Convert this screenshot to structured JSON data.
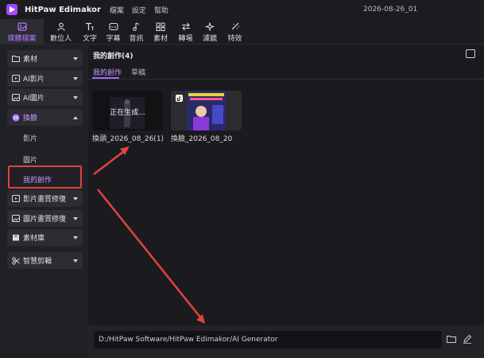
{
  "titlebar": {
    "app_name": "HitPaw Edimakor",
    "menu": [
      "檔案",
      "設定",
      "幫助"
    ],
    "project_name": "2026-08-26_01"
  },
  "toolbar": {
    "items": [
      {
        "label": "媒體檔案",
        "icon": "media-icon",
        "active": true
      },
      {
        "label": "數位人",
        "icon": "avatar-icon",
        "active": false
      },
      {
        "label": "文字",
        "icon": "text-icon",
        "active": false
      },
      {
        "label": "字幕",
        "icon": "subtitle-icon",
        "active": false
      },
      {
        "label": "音訊",
        "icon": "music-icon",
        "active": false
      },
      {
        "label": "素材",
        "icon": "sticker-icon",
        "active": false
      },
      {
        "label": "轉場",
        "icon": "transition-icon",
        "active": false
      },
      {
        "label": "濾鏡",
        "icon": "filter-icon",
        "active": false
      },
      {
        "label": "特效",
        "icon": "effects-icon",
        "active": false
      }
    ]
  },
  "sidebar": {
    "groups": [
      {
        "label": "素材",
        "icon": "folder-icon"
      },
      {
        "label": "AI影片",
        "icon": "ai-video-icon"
      },
      {
        "label": "AI圖片",
        "icon": "ai-image-icon"
      },
      {
        "label": "換臉",
        "icon": "face-swap-icon",
        "open": true
      },
      {
        "label": "影片畫質修復",
        "icon": "video-enhance-icon"
      },
      {
        "label": "圖片畫質修復",
        "icon": "image-enhance-icon"
      },
      {
        "label": "素材庫",
        "icon": "library-icon"
      },
      {
        "label": "智慧剪輯",
        "icon": "smart-cut-icon"
      }
    ],
    "subitems": [
      "影片",
      "圖片",
      "我的創作"
    ]
  },
  "main": {
    "title": "我的創作(4)",
    "tabs": [
      "我的創作",
      "草稿"
    ],
    "cards": [
      {
        "label": "換頭_2026_08_26(1)",
        "status": "正在生成..."
      },
      {
        "label": "換臉_2026_08_20",
        "status": ""
      }
    ]
  },
  "pathbar": {
    "path": "D:/HitPaw Software/HitPaw Edimakor/AI Generator"
  },
  "colors": {
    "accent": "#b57bff",
    "annotation": "#e0443a",
    "background": "#1b1b1f"
  }
}
